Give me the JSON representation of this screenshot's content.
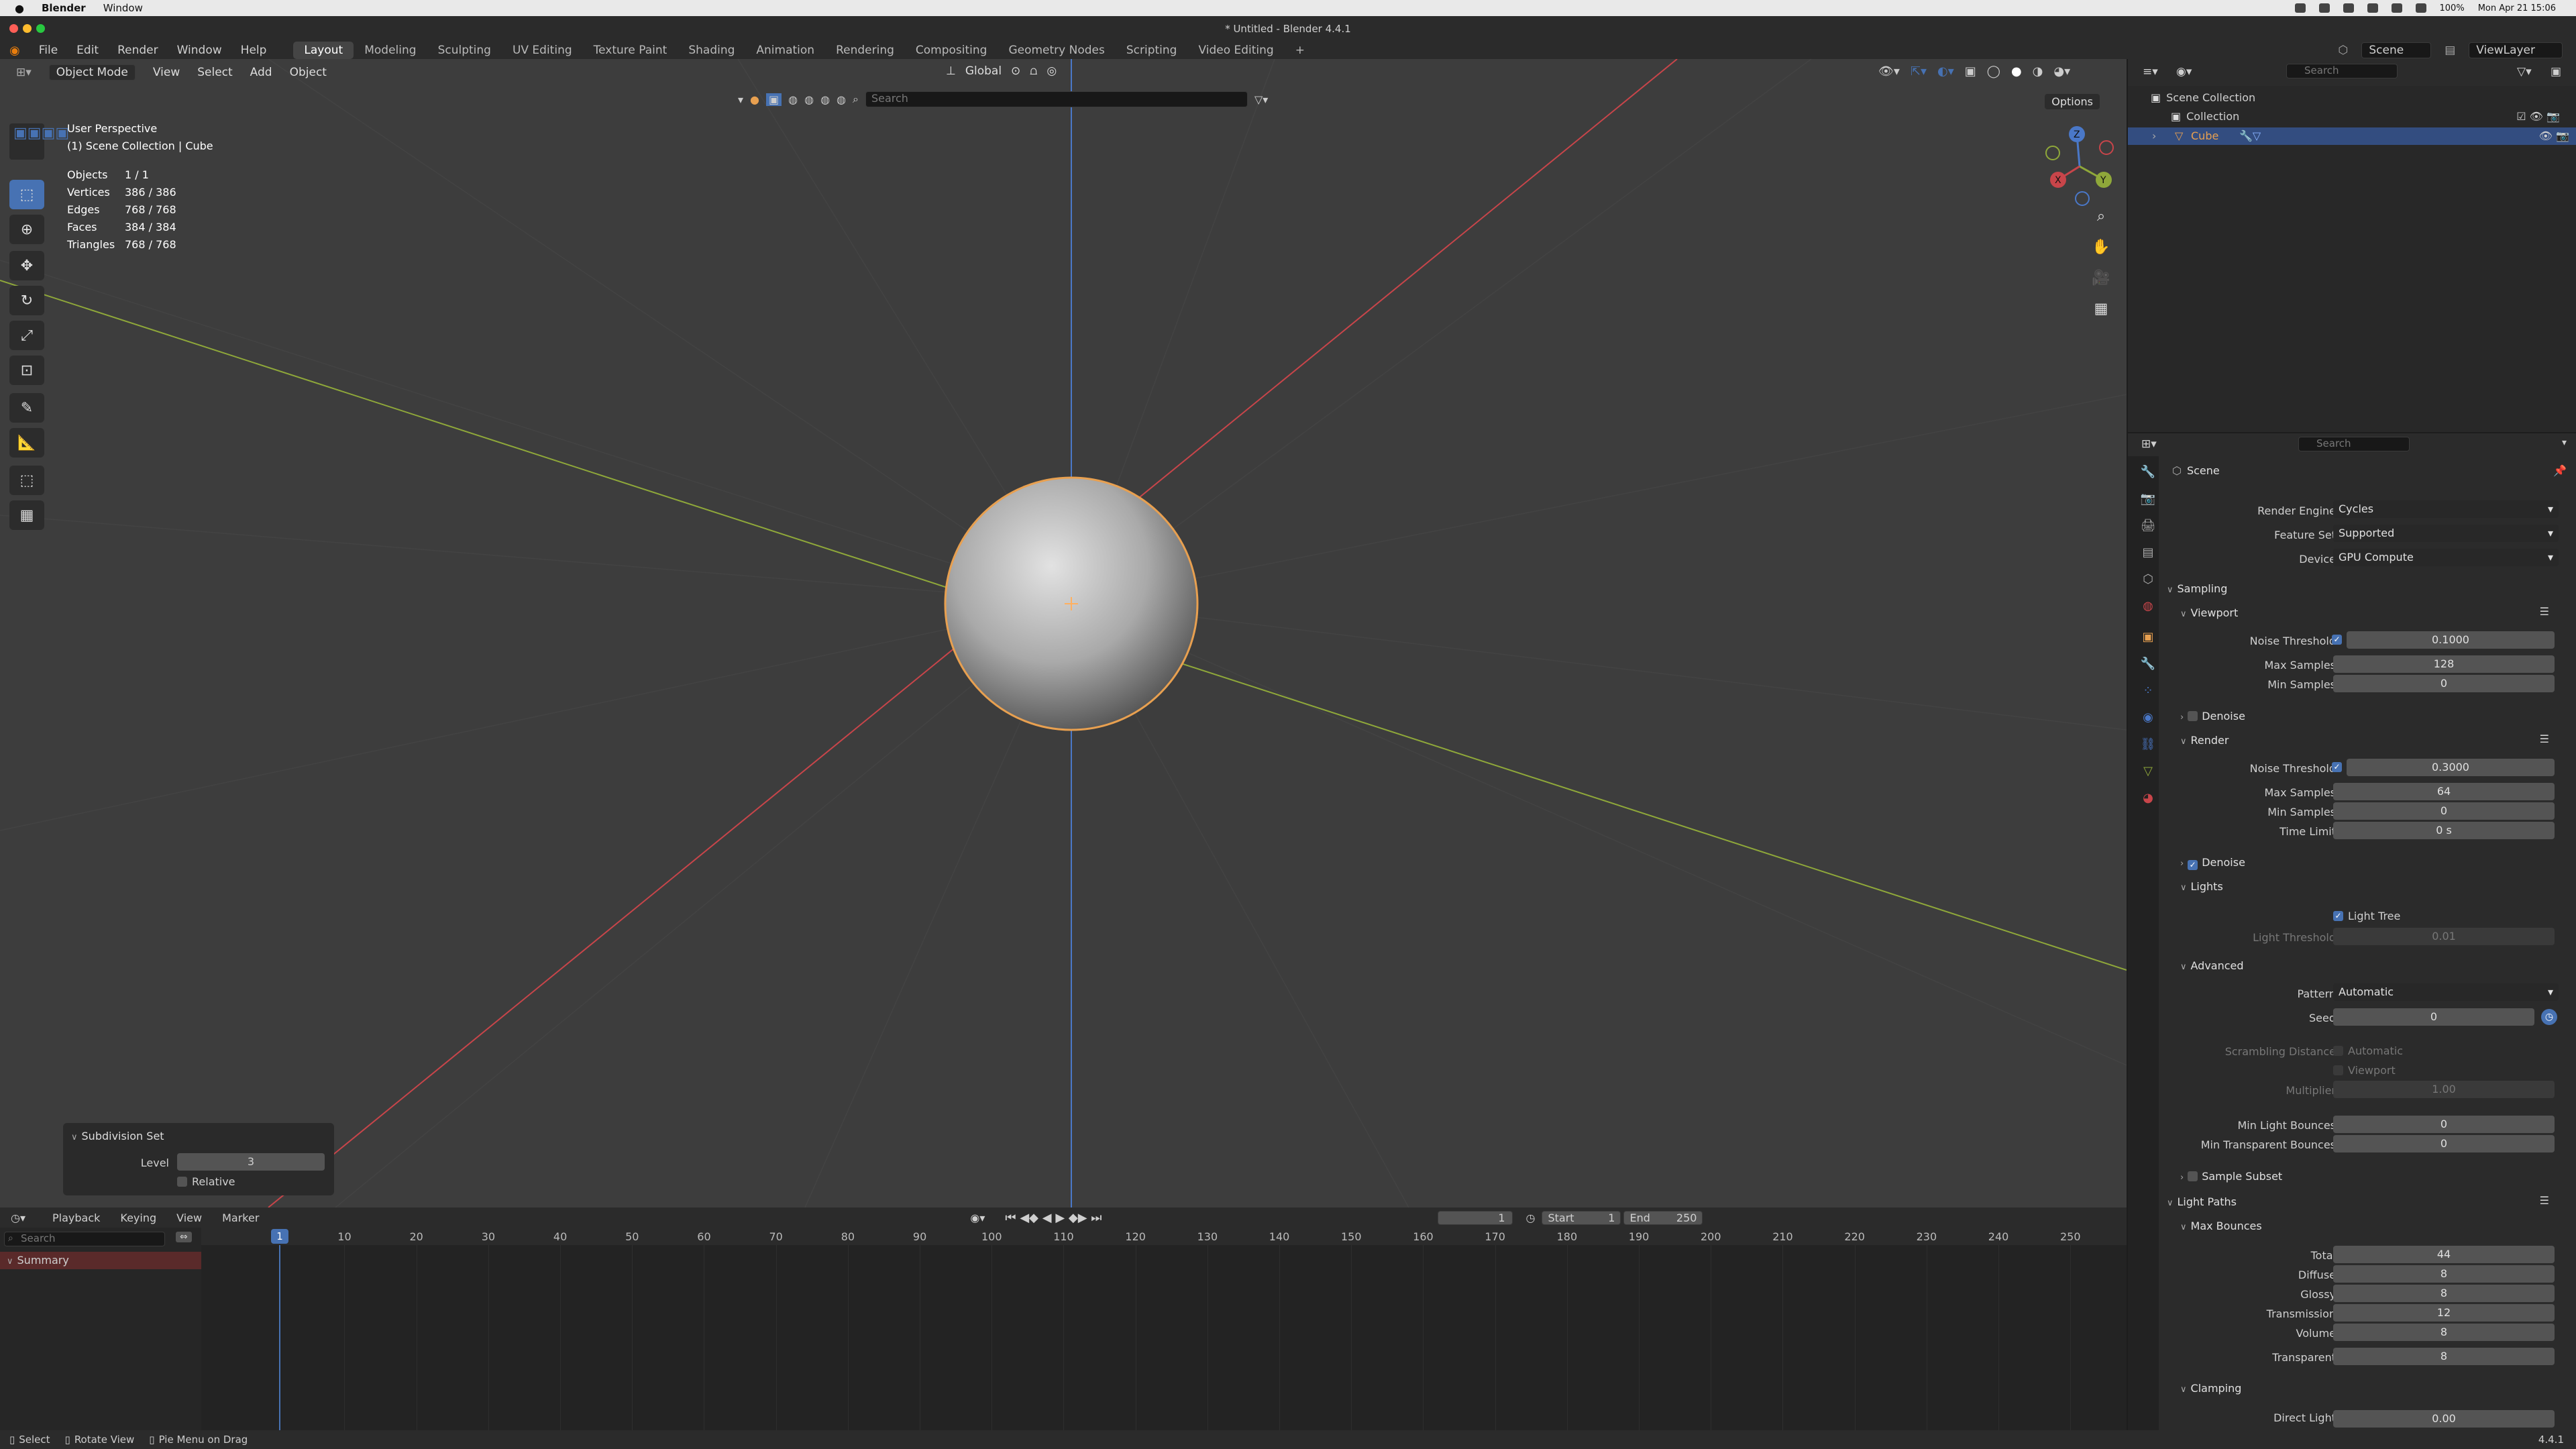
{
  "mac_menubar": {
    "app": "Blender",
    "window_menu": "Window",
    "datetime": "Mon Apr 21  15:06",
    "battery": "100%"
  },
  "window_title": "* Untitled - Blender 4.4.1",
  "top_menu": [
    "File",
    "Edit",
    "Render",
    "Window",
    "Help"
  ],
  "workspaces": [
    "Layout",
    "Modeling",
    "Sculpting",
    "UV Editing",
    "Texture Paint",
    "Shading",
    "Animation",
    "Rendering",
    "Compositing",
    "Geometry Nodes",
    "Scripting",
    "Video Editing"
  ],
  "active_workspace": "Layout",
  "scene_name": "Scene",
  "view_layer": "ViewLayer",
  "viewport": {
    "mode": "Object Mode",
    "menus": [
      "View",
      "Select",
      "Add",
      "Object"
    ],
    "transform_orientation": "Global",
    "search_placeholder": "Search",
    "options_label": "Options",
    "perspective": "User Perspective",
    "collection_path": "(1) Scene Collection | Cube",
    "stats": [
      {
        "label": "Objects",
        "value": "1 / 1"
      },
      {
        "label": "Vertices",
        "value": "386 / 386"
      },
      {
        "label": "Edges",
        "value": "768 / 768"
      },
      {
        "label": "Faces",
        "value": "384 / 384"
      },
      {
        "label": "Triangles",
        "value": "768 / 768"
      }
    ],
    "gizmo": {
      "z": "Z",
      "y": "Y",
      "x": "X"
    }
  },
  "operator_panel": {
    "title": "Subdivision Set",
    "level_label": "Level",
    "level_value": "3",
    "relative_label": "Relative"
  },
  "timeline": {
    "menus": [
      "Playback",
      "Keying",
      "View",
      "Marker"
    ],
    "current_frame": "1",
    "start_label": "Start",
    "start_value": "1",
    "end_label": "End",
    "end_value": "250",
    "search_placeholder": "Search",
    "summary_label": "Summary",
    "ruler": [
      "10",
      "20",
      "30",
      "40",
      "50",
      "60",
      "70",
      "80",
      "90",
      "100",
      "110",
      "120",
      "130",
      "140",
      "150",
      "160",
      "170",
      "180",
      "190",
      "200",
      "210",
      "220",
      "230",
      "240",
      "250"
    ],
    "ruler_current": "1"
  },
  "statusbar": {
    "items": [
      "Select",
      "Rotate View",
      "Pie Menu on Drag"
    ],
    "version": "4.4.1"
  },
  "outliner": {
    "search_placeholder": "Search",
    "root": "Scene Collection",
    "collection": "Collection",
    "object": "Cube"
  },
  "properties": {
    "search_placeholder": "Search",
    "context": "Scene",
    "render_engine_label": "Render Engine",
    "render_engine": "Cycles",
    "feature_set_label": "Feature Set",
    "feature_set": "Supported",
    "device_label": "Device",
    "device": "GPU Compute",
    "sampling": "Sampling",
    "viewport_sec": "Viewport",
    "noise_threshold_label": "Noise Threshold",
    "vp_noise_threshold": "0.1000",
    "max_samples_label": "Max Samples",
    "vp_max_samples": "128",
    "min_samples_label": "Min Samples",
    "vp_min_samples": "0",
    "denoise_label": "Denoise",
    "render_sec": "Render",
    "r_noise_threshold": "0.3000",
    "r_max_samples": "64",
    "r_min_samples": "0",
    "time_limit_label": "Time Limit",
    "r_time_limit": "0 s",
    "lights_sec": "Lights",
    "light_tree_label": "Light Tree",
    "light_threshold_label": "Light Threshold",
    "light_threshold": "0.01",
    "advanced_sec": "Advanced",
    "pattern_label": "Pattern",
    "pattern": "Automatic",
    "seed_label": "Seed",
    "seed": "0",
    "scrambling_label": "Scrambling Distance",
    "scr_automatic": "Automatic",
    "scr_viewport": "Viewport",
    "multiplier_label": "Multiplier",
    "multiplier": "1.00",
    "min_light_bounces_label": "Min Light Bounces",
    "min_light_bounces": "0",
    "min_transparent_bounces_label": "Min Transparent Bounces",
    "min_transparent_bounces": "0",
    "sample_subset_label": "Sample Subset",
    "light_paths_sec": "Light Paths",
    "max_bounces_sec": "Max Bounces",
    "total_label": "Total",
    "total": "44",
    "diffuse_label": "Diffuse",
    "diffuse": "8",
    "glossy_label": "Glossy",
    "glossy": "8",
    "transmission_label": "Transmission",
    "transmission": "12",
    "volume_label": "Volume",
    "volume": "8",
    "transparent_label": "Transparent",
    "transparent": "8",
    "clamping_sec": "Clamping",
    "direct_light_label": "Direct Light",
    "direct_light": "0.00"
  },
  "colors": {
    "accent": "#4772b3",
    "selection_orange": "#e8a050",
    "x_axis": "#c8454a",
    "y_axis": "#8fa83a",
    "z_axis": "#4a78c8"
  }
}
